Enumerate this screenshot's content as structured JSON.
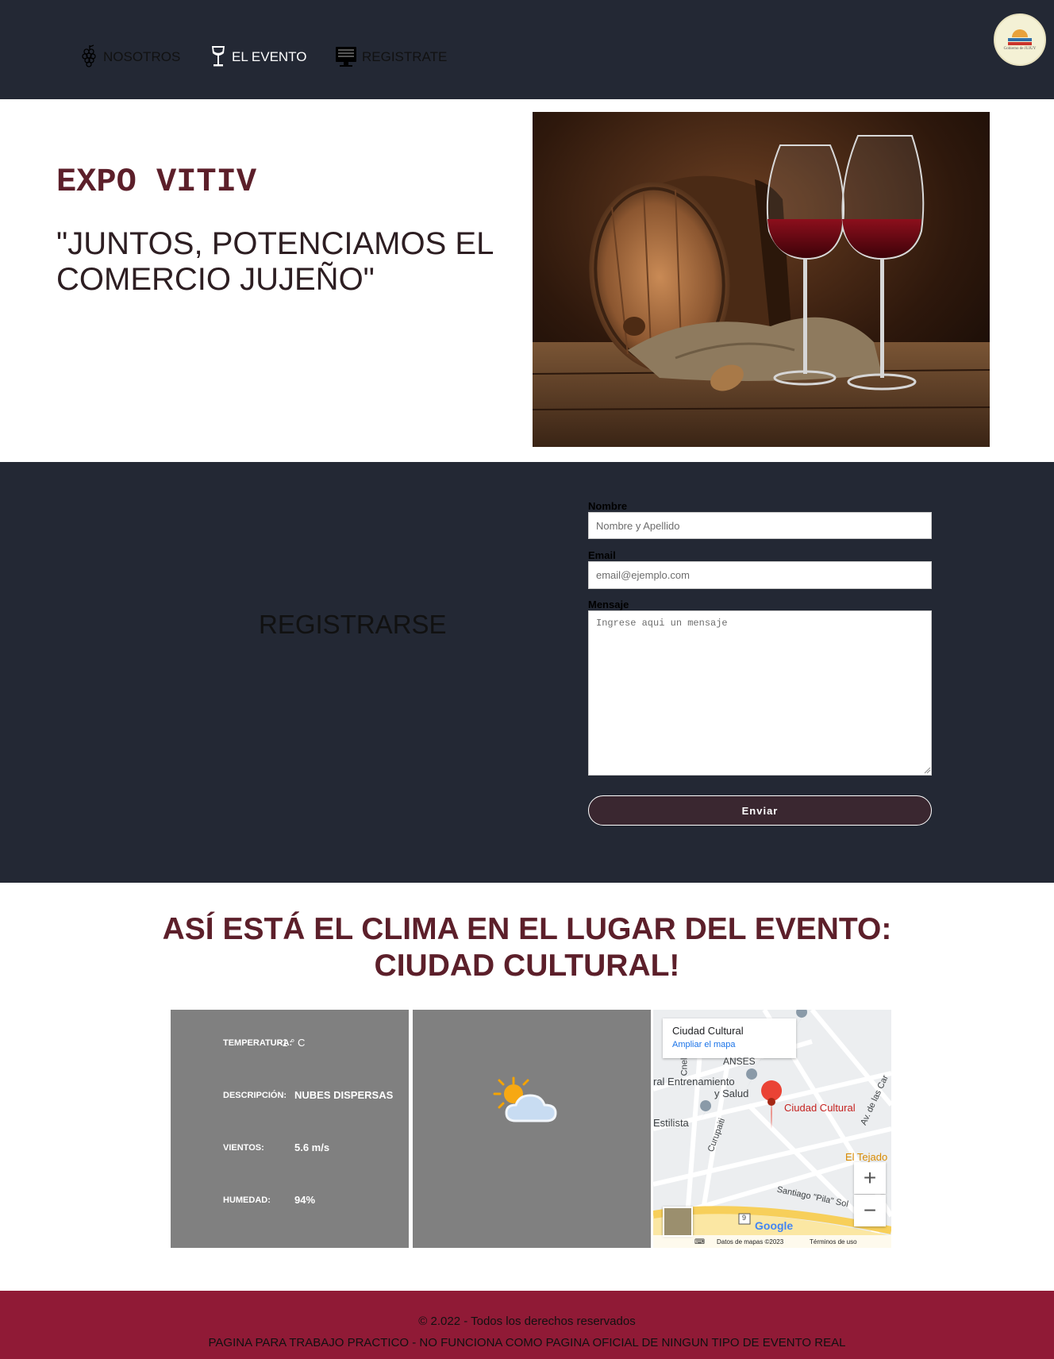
{
  "nav": {
    "items": [
      {
        "label": "NOSOTROS",
        "icon": "grapes-icon"
      },
      {
        "label": "EL EVENTO",
        "icon": "wine-glass-icon"
      },
      {
        "label": "REGISTRATE",
        "icon": "computer-icon"
      }
    ],
    "logo_text": "Gobierno de JUJUY"
  },
  "hero": {
    "title": "EXPO VITIV",
    "slogan": "\"JUNTOS, POTENCIAMOS EL COMERCIO JUJEÑO\""
  },
  "form": {
    "section_title": "REGISTRARSE",
    "name_label": "Nombre",
    "name_placeholder": "Nombre y Apellido",
    "email_label": "Email",
    "email_placeholder": "email@ejemplo.com",
    "message_label": "Mensaje",
    "message_placeholder": "Ingrese aqui un mensaje",
    "submit_label": "Enviar"
  },
  "weather": {
    "heading_line1": "ASÍ ESTÁ EL CLIMA EN EL LUGAR DEL EVENTO:",
    "heading_line2": "CIUDAD CULTURAL!",
    "rows": [
      {
        "key": "TEMPERATURA:",
        "value": "-1 ° C"
      },
      {
        "key": "DESCRIPCIÓN:",
        "value": "NUBES DISPERSAS"
      },
      {
        "key": "VIENTOS:",
        "value": "5.6 m/s"
      },
      {
        "key": "HUMEDAD:",
        "value": "94%"
      }
    ],
    "icon": "partly-cloudy-icon"
  },
  "map": {
    "place_title": "Ciudad Cultural",
    "expand_link": "Ampliar el mapa",
    "labels": {
      "pin": "Ciudad Cultural",
      "entrenamiento_1": "ral Entrenamiento",
      "entrenamiento_2": "y Salud",
      "estilista": "Estilista",
      "anses": "ANSES",
      "tejado": "El Tejado",
      "curupaiti": "Curupaiti",
      "av_cas": "Av. de las Car",
      "santiago": "Santiago \"Pila\" Sol",
      "cneI": "Cnel",
      "route": "9"
    },
    "zoom_in": "+",
    "zoom_out": "−",
    "brand": "Google",
    "data_text": "Datos de mapas ©2023",
    "terms_text": "Términos de uso"
  },
  "footer": {
    "copyright": "© 2.022 - Todos los derechos reservados",
    "disclaimer": "PAGINA PARA TRABAJO PRACTICO - NO FUNCIONA COMO PAGINA OFICIAL DE NINGUN TIPO DE EVENTO REAL"
  },
  "colors": {
    "dark_bg": "#232834",
    "wine": "#5c1f2a",
    "footer_bg": "#901a36",
    "weather_panel": "#808080"
  }
}
